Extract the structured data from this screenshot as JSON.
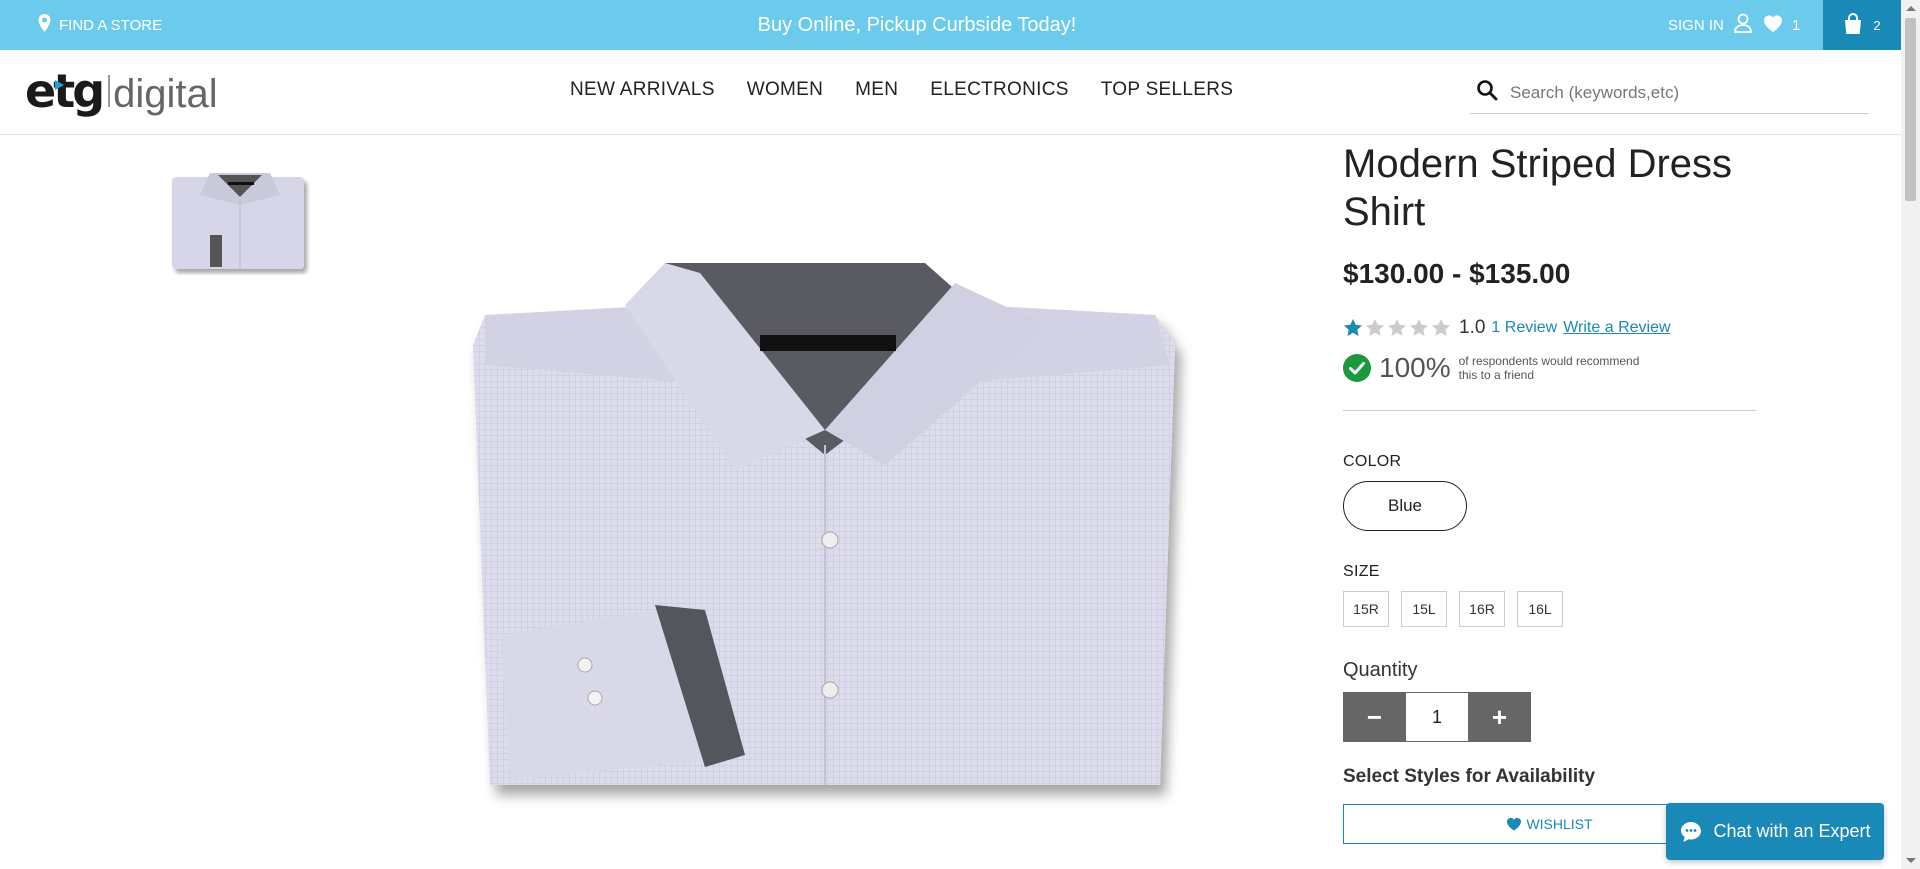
{
  "topbar": {
    "find_store": "FIND A STORE",
    "promo": "Buy Online, Pickup Curbside Today!",
    "sign_in": "SIGN IN",
    "wishlist_count": "1",
    "cart_count": "2",
    "bg_color": "#6ccaec",
    "cart_color": "#1989b8"
  },
  "header": {
    "logo_etg": "etg",
    "logo_digital": "digital",
    "nav": [
      "NEW ARRIVALS",
      "WOMEN",
      "MEN",
      "ELECTRONICS",
      "TOP SELLERS"
    ],
    "search_placeholder": "Search (keywords,etc)"
  },
  "product": {
    "title": "Modern Striped Dress Shirt",
    "price": "$130.00 - $135.00",
    "rating": "1.0",
    "rating_value": 1,
    "rating_max": 5,
    "review_link": "1 Review",
    "write_review": "Write a Review",
    "recommend_pct": "100%",
    "recommend_text": "of respondents would recommend this to a friend",
    "color_label": "COLOR",
    "color_value": "Blue",
    "size_label": "SIZE",
    "sizes": [
      "15R",
      "15L",
      "16R",
      "16L"
    ],
    "quantity_label": "Quantity",
    "quantity": "1",
    "minus": "−",
    "plus": "+",
    "availability": "Select Styles for Availability",
    "wishlist_btn": "WISHLIST"
  },
  "chat": {
    "label": "Chat with an Expert"
  },
  "icons": {
    "find_store": "map-pin-icon",
    "sign_in": "user-icon",
    "wishlist": "heart-icon",
    "cart": "shopping-bag-icon",
    "search": "search-icon",
    "recommend": "check-circle-icon",
    "chat": "chat-bubble-icon"
  }
}
